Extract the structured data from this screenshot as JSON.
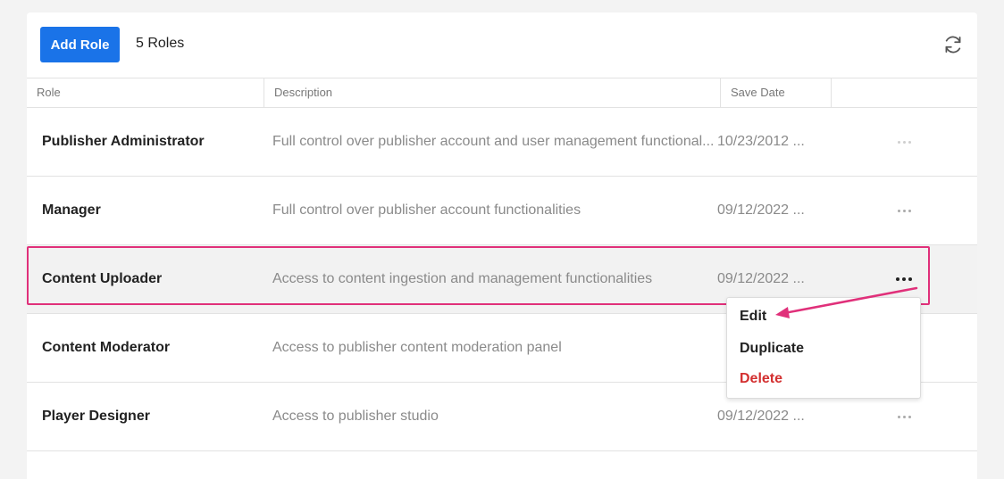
{
  "toolbar": {
    "add_label": "Add Role",
    "count_label": "5 Roles"
  },
  "table": {
    "columns": [
      "Role",
      "Description",
      "Save Date"
    ],
    "rows": [
      {
        "role": "Publisher Administrator",
        "description": "Full control over publisher account and user management functional...",
        "save_date": "10/23/2012 ..."
      },
      {
        "role": "Manager",
        "description": "Full control over publisher account functionalities",
        "save_date": "09/12/2022 ..."
      },
      {
        "role": "Content Uploader",
        "description": "Access to content ingestion and management functionalities",
        "save_date": "09/12/2022 ..."
      },
      {
        "role": "Content Moderator",
        "description": "Access to publisher content moderation panel",
        "save_date": ""
      },
      {
        "role": "Player Designer",
        "description": "Access to publisher studio",
        "save_date": "09/12/2022 ..."
      }
    ]
  },
  "context_menu": {
    "items": [
      "Edit",
      "Duplicate",
      "Delete"
    ]
  },
  "colors": {
    "primary": "#1a73e8",
    "highlight": "#e0307a",
    "danger": "#d32f2f"
  }
}
